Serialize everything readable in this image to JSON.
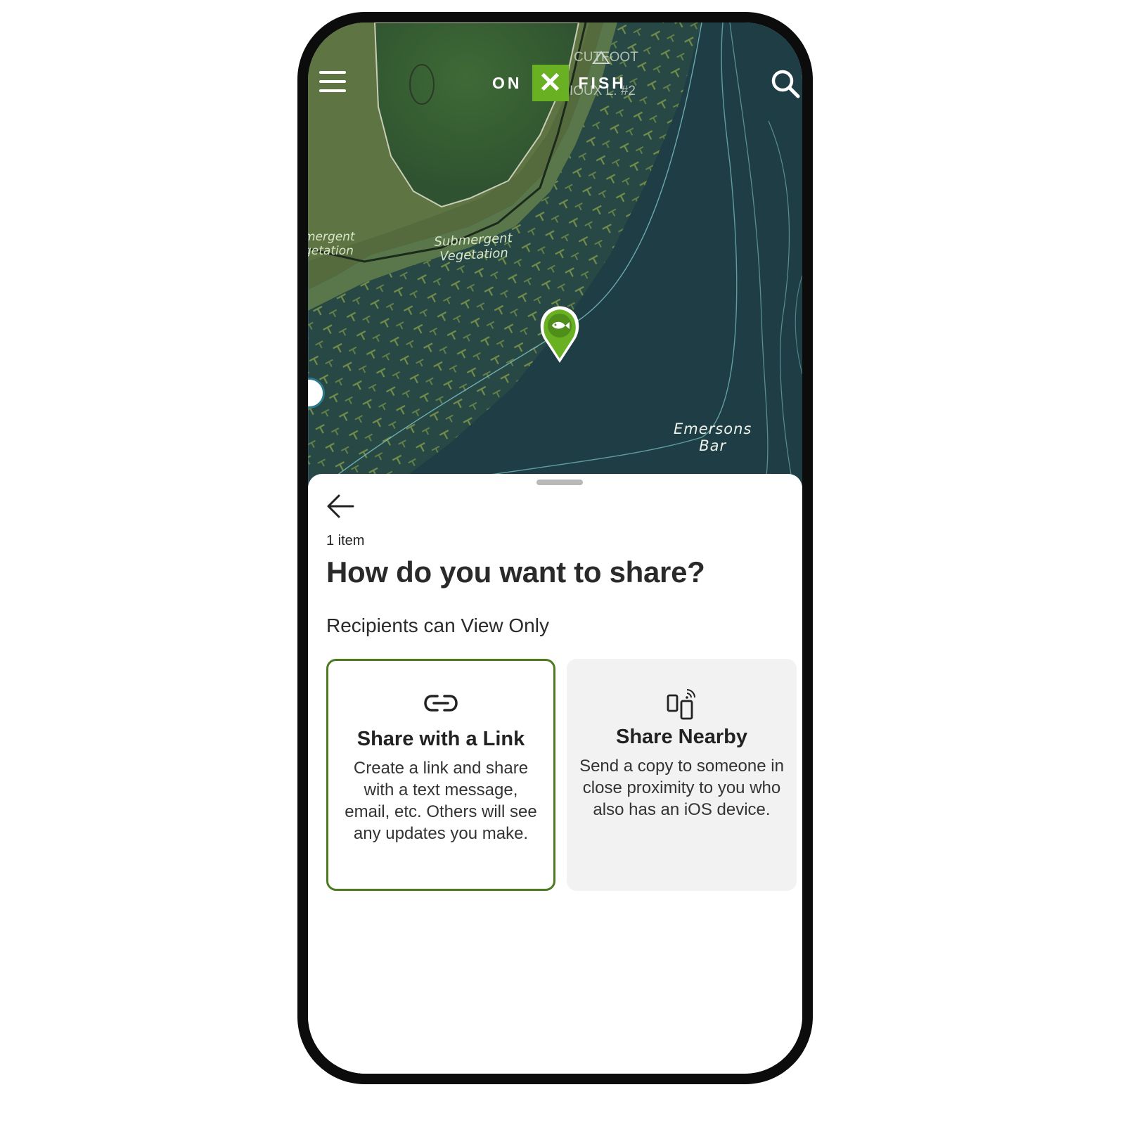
{
  "app": {
    "logo_left": "ON",
    "logo_mark": "✕",
    "logo_right": "FISH",
    "brand_color": "#6ab023",
    "icons": {
      "menu": "hamburger-menu-icon",
      "search": "search-icon",
      "pin": "fish-marker-icon",
      "back": "arrow-left-icon"
    }
  },
  "map": {
    "labels": {
      "emergent_line1": "mergent",
      "emergent_line2": "getation",
      "submergent_line1": "Submergent",
      "submergent_line2": "Vegetation",
      "bar_line1": "Emersons",
      "bar_line2": "Bar",
      "ghost_line1": "CUTFOOT",
      "ghost_line2": "IOUX L. #2"
    }
  },
  "sheet": {
    "item_count": "1 item",
    "title": "How do you want to share?",
    "subtitle": "Recipients can View Only",
    "options": [
      {
        "id": "link",
        "icon": "link-icon",
        "title": "Share with a Link",
        "description": "Create a link and share with a text message, email, etc. Others will see any updates you make.",
        "selected": true,
        "border_color": "#4d7a1f"
      },
      {
        "id": "nearby",
        "icon": "share-nearby-devices-icon",
        "title": "Share Nearby",
        "description": "Send a copy to someone in close proximity to you who also has an iOS device.",
        "selected": false,
        "background_color": "#f2f2f2"
      }
    ]
  }
}
